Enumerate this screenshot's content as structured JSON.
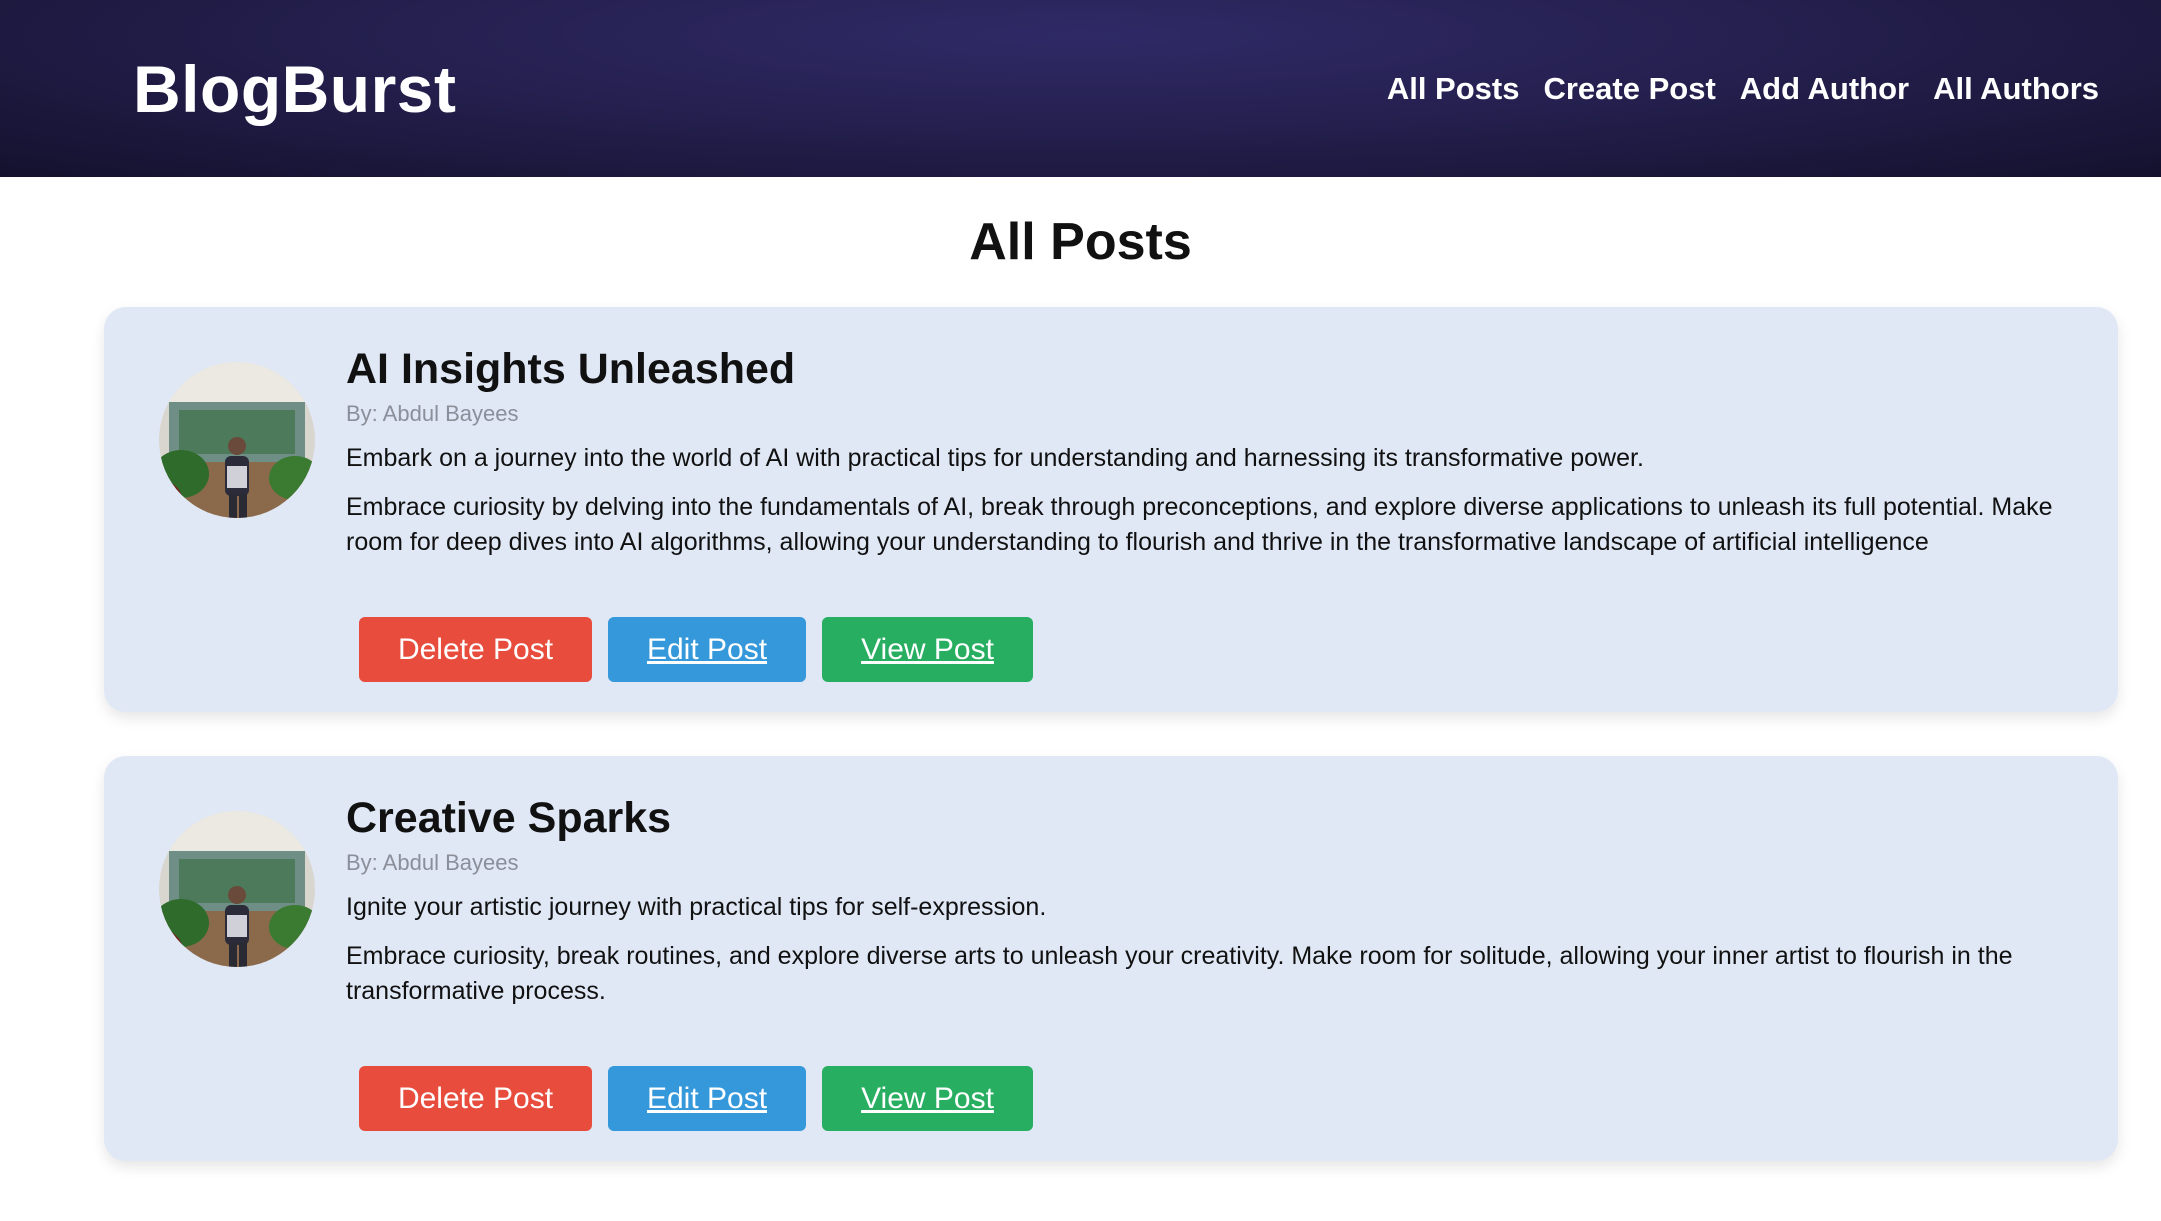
{
  "header": {
    "logo": "BlogBurst",
    "nav": [
      "All Posts",
      "Create Post",
      "Add Author",
      "All Authors"
    ]
  },
  "page": {
    "title": "All Posts"
  },
  "posts": [
    {
      "title": "AI Insights Unleashed",
      "author": "By: Abdul Bayees",
      "description": "Embark on a journey into the world of AI with practical tips for understanding and harnessing its transformative power.",
      "content": "Embrace curiosity by delving into the fundamentals of AI, break through preconceptions, and explore diverse applications to unleash its full potential. Make room for deep dives into AI algorithms, allowing your understanding to flourish and thrive in the transformative landscape of artificial intelligence",
      "delete_label": "Delete Post",
      "edit_label": "Edit Post",
      "view_label": "View Post"
    },
    {
      "title": "Creative Sparks",
      "author": "By: Abdul Bayees",
      "description": "Ignite your artistic journey with practical tips for self-expression.",
      "content": "Embrace curiosity, break routines, and explore diverse arts to unleash your creativity. Make room for solitude, allowing your inner artist to flourish in the transformative process.",
      "delete_label": "Delete Post",
      "edit_label": "Edit Post",
      "view_label": "View Post"
    }
  ],
  "colors": {
    "header_bg": "#25204f",
    "card_bg": "#e0e8f6",
    "delete": "#e74c3c",
    "edit": "#3498db",
    "view": "#27ae60"
  }
}
